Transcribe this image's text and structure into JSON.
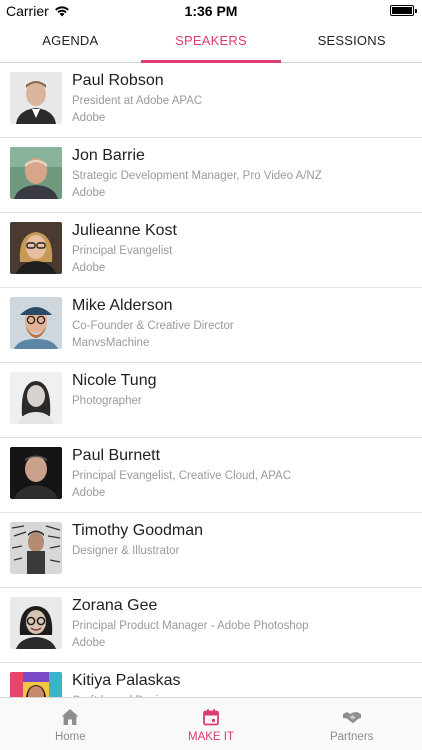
{
  "status_bar": {
    "carrier": "Carrier",
    "time": "1:36 PM"
  },
  "tabs": [
    {
      "label": "AGENDA",
      "active": false
    },
    {
      "label": "SPEAKERS",
      "active": true
    },
    {
      "label": "SESSIONS",
      "active": false
    }
  ],
  "speakers": [
    {
      "name": "Paul Robson",
      "role": "President at Adobe APAC",
      "company": "Adobe"
    },
    {
      "name": "Jon Barrie",
      "role": "Strategic Development Manager, Pro Video A/NZ",
      "company": "Adobe"
    },
    {
      "name": "Julieanne Kost",
      "role": "Principal Evangelist",
      "company": "Adobe"
    },
    {
      "name": "Mike Alderson",
      "role": "Co-Founder & Creative Director",
      "company": "ManvsMachine"
    },
    {
      "name": "Nicole Tung",
      "role": "Photographer",
      "company": ""
    },
    {
      "name": "Paul Burnett",
      "role": "Principal Evangelist, Creative Cloud, APAC",
      "company": "Adobe"
    },
    {
      "name": "Timothy Goodman",
      "role": "Designer & Illustrator",
      "company": ""
    },
    {
      "name": "Zorana Gee",
      "role": "Principal Product Manager - Adobe Photoshop",
      "company": "Adobe"
    },
    {
      "name": "Kitiya Palaskas",
      "role": "Craft-based Designer",
      "company": ""
    }
  ],
  "bottom_nav": [
    {
      "label": "Home",
      "icon": "home-icon",
      "active": false
    },
    {
      "label": "MAKE IT",
      "icon": "calendar-icon",
      "active": true
    },
    {
      "label": "Partners",
      "icon": "handshake-icon",
      "active": false
    }
  ],
  "colors": {
    "accent": "#e03b6f",
    "secondary_text": "#9a9a9a",
    "inactive_nav": "#8e8e8e"
  }
}
